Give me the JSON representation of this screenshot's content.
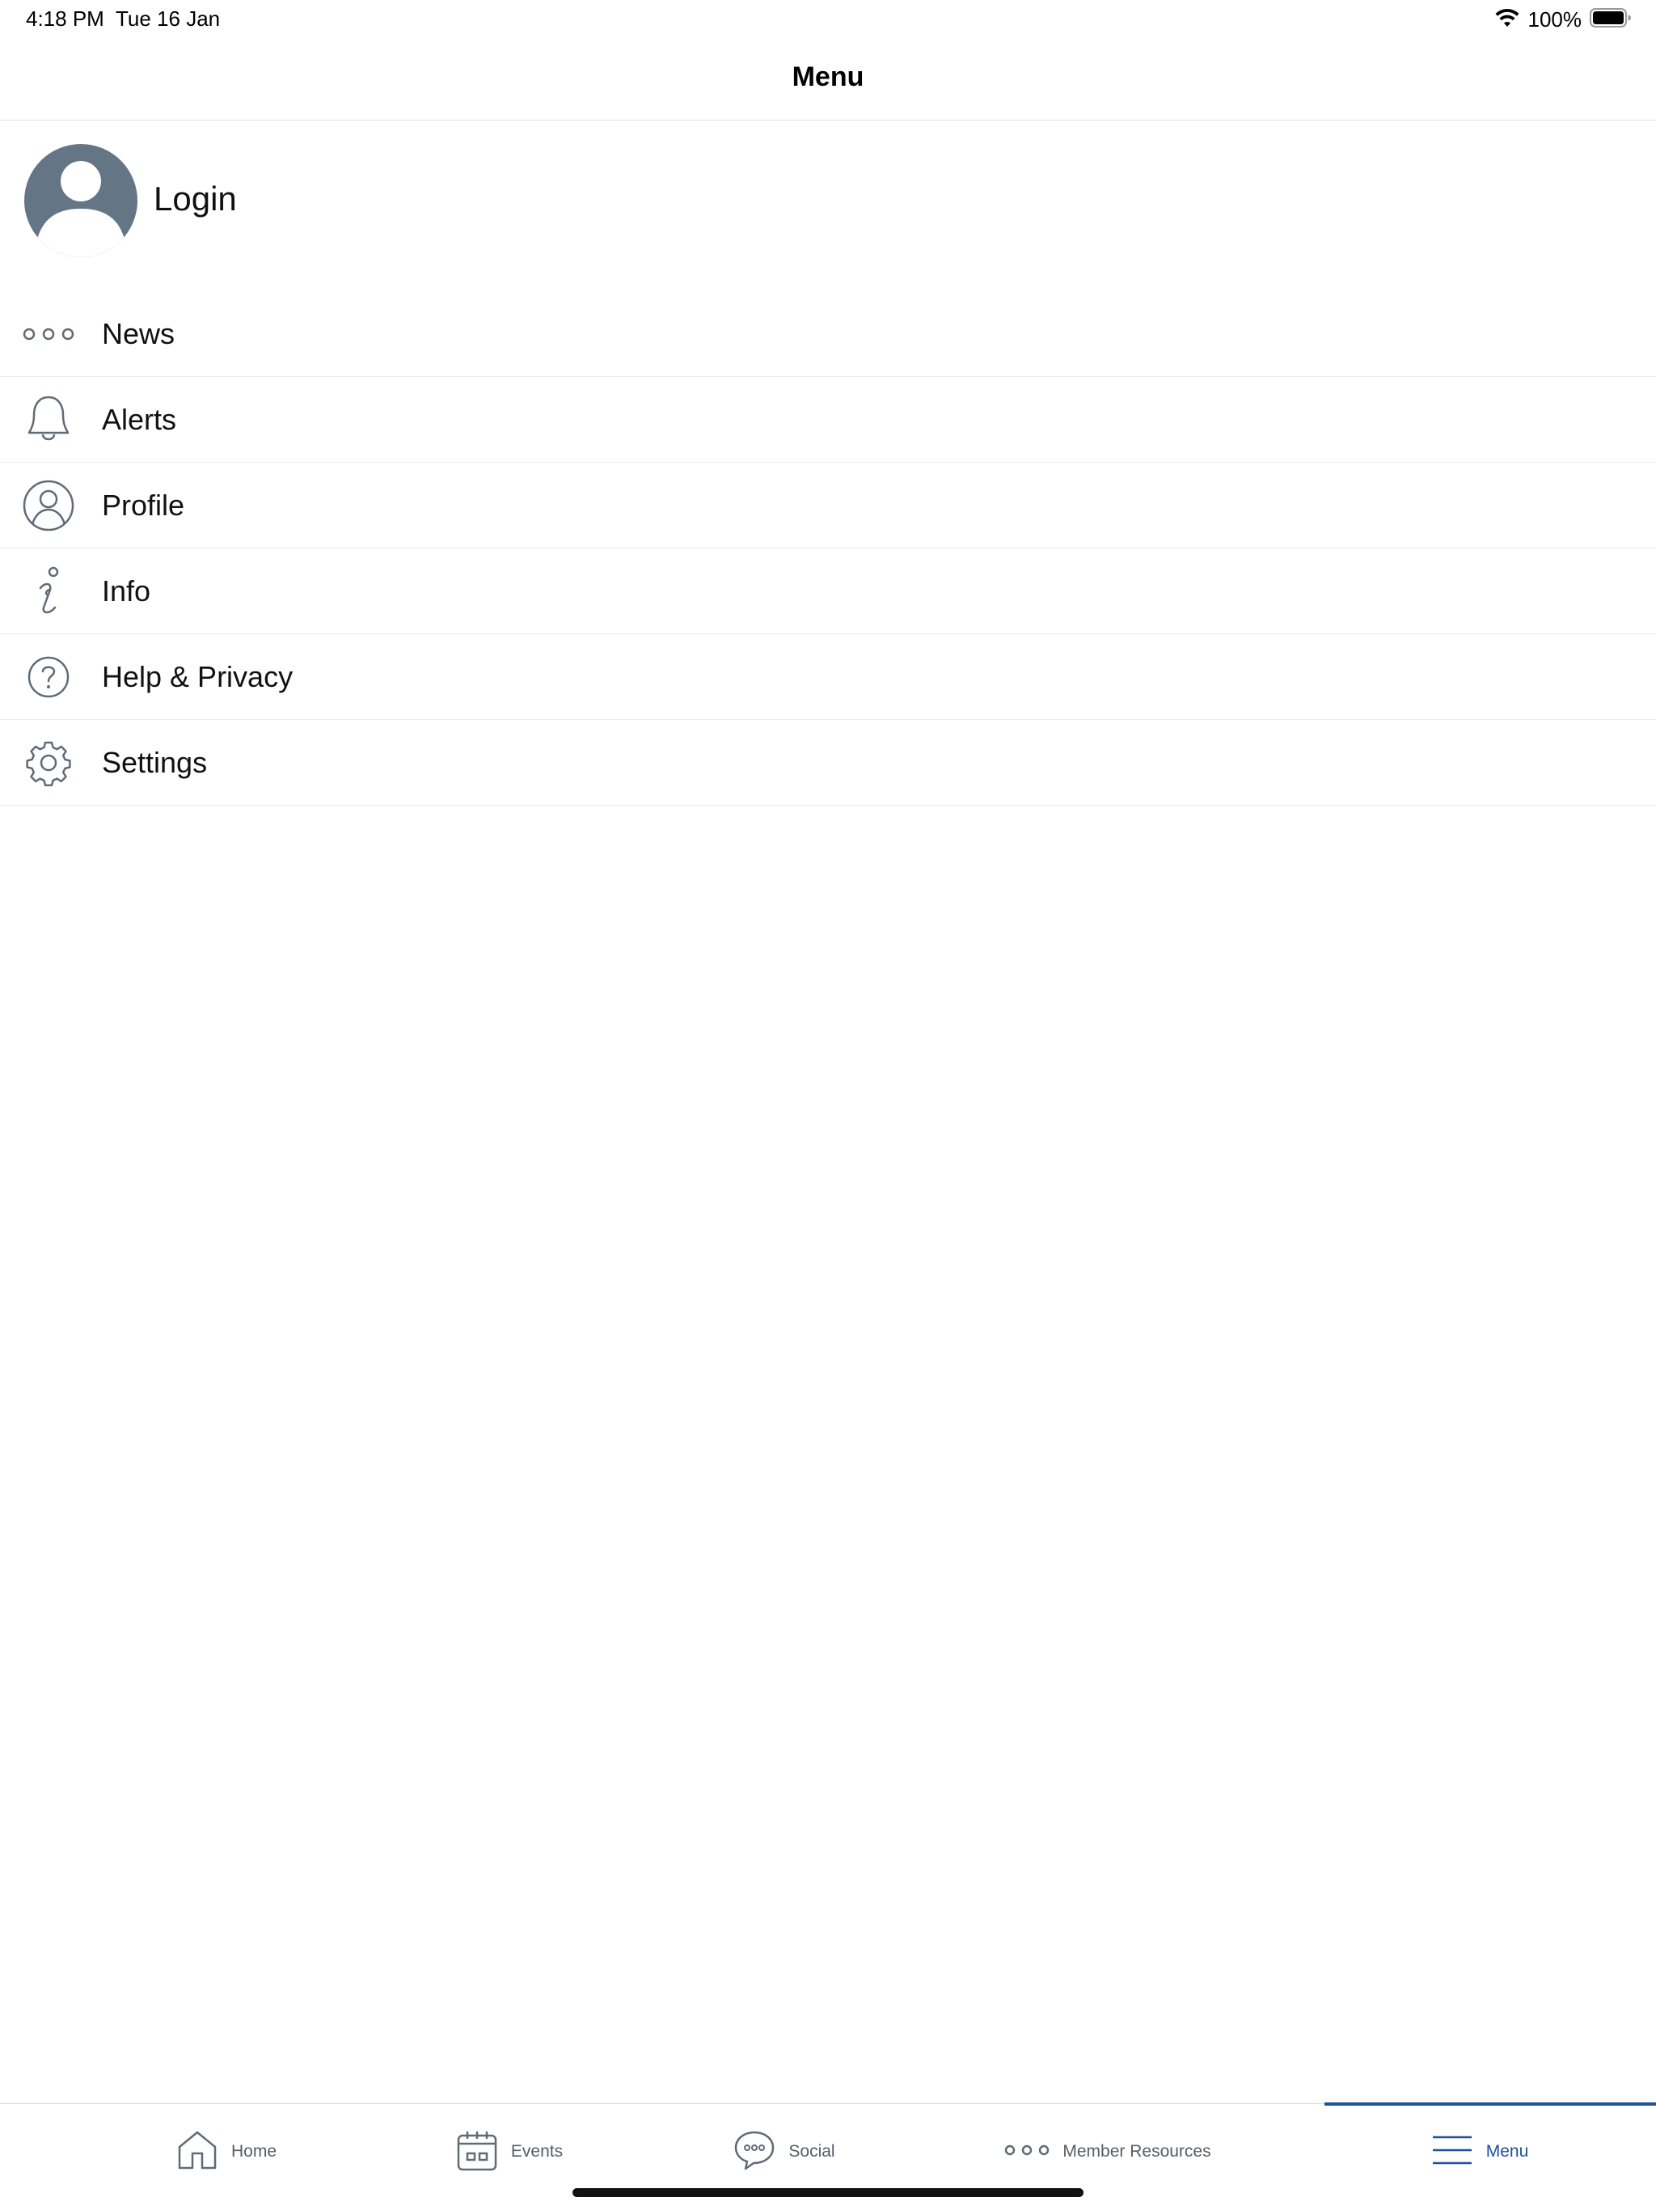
{
  "status_bar": {
    "time": "4:18 PM",
    "date": "Tue 16 Jan",
    "battery": "100%",
    "icons": [
      "wifi-icon",
      "battery-icon"
    ]
  },
  "nav": {
    "title": "Menu"
  },
  "login": {
    "label": "Login",
    "icon": "avatar-icon"
  },
  "menu": {
    "items": [
      {
        "label": "News",
        "icon": "more-dots-icon"
      },
      {
        "label": "Alerts",
        "icon": "bell-icon"
      },
      {
        "label": "Profile",
        "icon": "user-circle-icon"
      },
      {
        "label": "Info",
        "icon": "info-icon"
      },
      {
        "label": "Help & Privacy",
        "icon": "question-circle-icon"
      },
      {
        "label": "Settings",
        "icon": "gear-icon"
      }
    ]
  },
  "tabs": {
    "active": "Menu",
    "items": [
      {
        "label": "Home",
        "icon": "home-icon"
      },
      {
        "label": "Events",
        "icon": "calendar-icon"
      },
      {
        "label": "Social",
        "icon": "chat-bubble-icon"
      },
      {
        "label": "Member Resources",
        "icon": "more-dots-icon"
      },
      {
        "label": "Menu",
        "icon": "hamburger-icon"
      }
    ]
  },
  "colors": {
    "accent": "#1f4fa0",
    "icon_gray": "#5f6b76",
    "avatar_bg": "#647585",
    "divider": "#ececec"
  }
}
